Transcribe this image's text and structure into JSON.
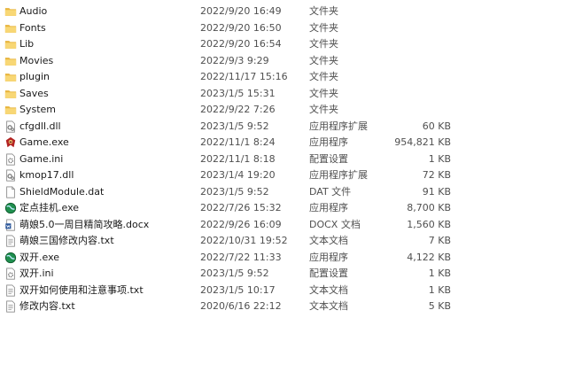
{
  "files": [
    {
      "name": "Audio",
      "date": "2022/9/20 16:49",
      "type": "文件夹",
      "size": "",
      "icon": "folder-icon"
    },
    {
      "name": "Fonts",
      "date": "2022/9/20 16:50",
      "type": "文件夹",
      "size": "",
      "icon": "folder-icon"
    },
    {
      "name": "Lib",
      "date": "2022/9/20 16:54",
      "type": "文件夹",
      "size": "",
      "icon": "folder-icon"
    },
    {
      "name": "Movies",
      "date": "2022/9/3 9:29",
      "type": "文件夹",
      "size": "",
      "icon": "folder-icon"
    },
    {
      "name": "plugin",
      "date": "2022/11/17 15:16",
      "type": "文件夹",
      "size": "",
      "icon": "folder-icon"
    },
    {
      "name": "Saves",
      "date": "2023/1/5 15:31",
      "type": "文件夹",
      "size": "",
      "icon": "folder-icon"
    },
    {
      "name": "System",
      "date": "2022/9/22 7:26",
      "type": "文件夹",
      "size": "",
      "icon": "folder-icon"
    },
    {
      "name": "cfgdll.dll",
      "date": "2023/1/5 9:52",
      "type": "应用程序扩展",
      "size": "60 KB",
      "icon": "dll-icon"
    },
    {
      "name": "Game.exe",
      "date": "2022/11/1 8:24",
      "type": "应用程序",
      "size": "954,821 KB",
      "icon": "game-exe-icon"
    },
    {
      "name": "Game.ini",
      "date": "2022/11/1 8:18",
      "type": "配置设置",
      "size": "1 KB",
      "icon": "ini-icon"
    },
    {
      "name": "kmop17.dll",
      "date": "2023/1/4 19:20",
      "type": "应用程序扩展",
      "size": "72 KB",
      "icon": "dll-icon"
    },
    {
      "name": "ShieldModule.dat",
      "date": "2023/1/5 9:52",
      "type": "DAT 文件",
      "size": "91 KB",
      "icon": "dat-icon"
    },
    {
      "name": "定点挂机.exe",
      "date": "2022/7/26 15:32",
      "type": "应用程序",
      "size": "8,700 KB",
      "icon": "globe-exe-icon"
    },
    {
      "name": "萌娘5.0一周目精简攻略.docx",
      "date": "2022/9/26 16:09",
      "type": "DOCX 文档",
      "size": "1,560 KB",
      "icon": "document-icon"
    },
    {
      "name": "萌娘三国修改内容.txt",
      "date": "2022/10/31 19:52",
      "type": "文本文档",
      "size": "7 KB",
      "icon": "text-file-icon"
    },
    {
      "name": "双开.exe",
      "date": "2022/7/22 11:33",
      "type": "应用程序",
      "size": "4,122 KB",
      "icon": "globe-exe-icon"
    },
    {
      "name": "双开.ini",
      "date": "2023/1/5 9:52",
      "type": "配置设置",
      "size": "1 KB",
      "icon": "ini-icon"
    },
    {
      "name": "双开如何使用和注意事项.txt",
      "date": "2023/1/5 10:17",
      "type": "文本文档",
      "size": "1 KB",
      "icon": "text-file-icon"
    },
    {
      "name": "修改内容.txt",
      "date": "2020/6/16 22:12",
      "type": "文本文档",
      "size": "5 KB",
      "icon": "text-file-icon"
    }
  ]
}
